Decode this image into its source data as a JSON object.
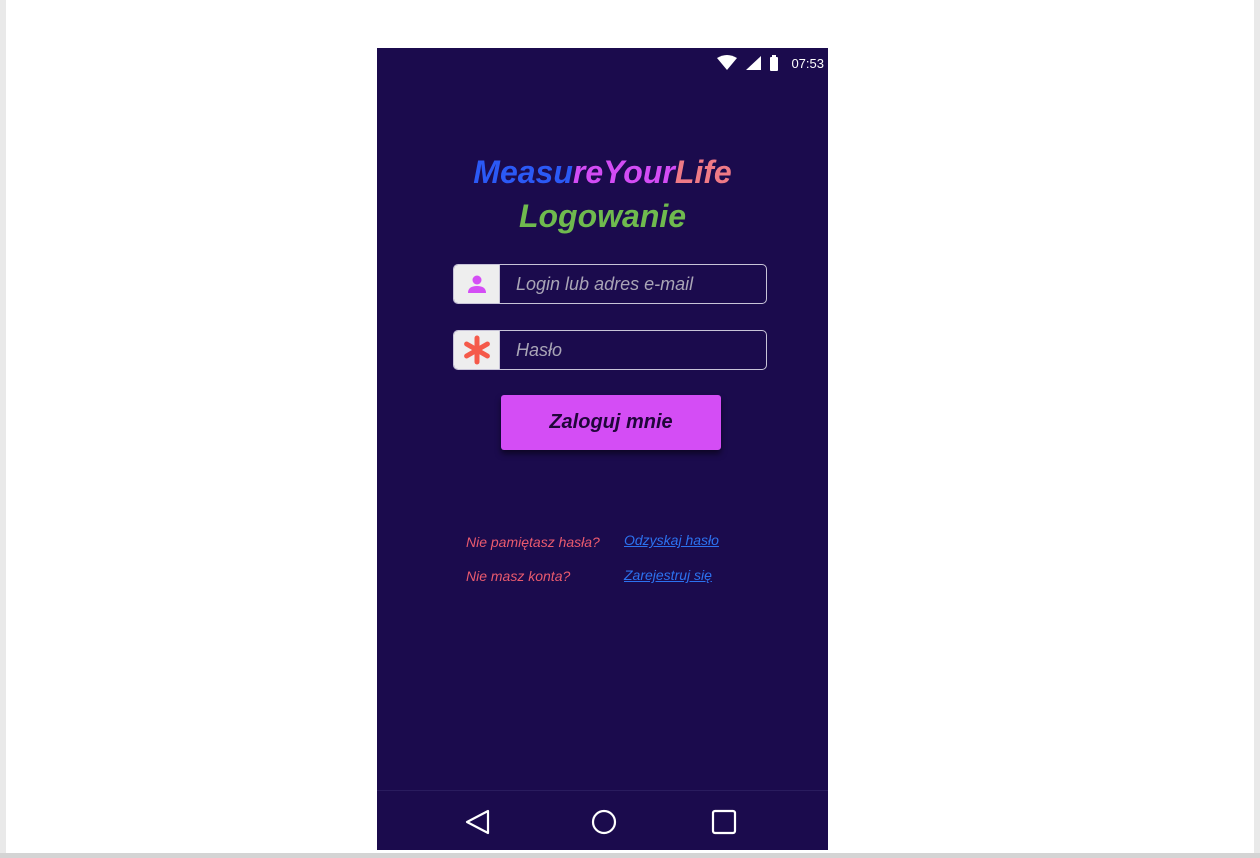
{
  "status_bar": {
    "time": "07:53",
    "icons": [
      "wifi-icon",
      "signal-icon",
      "battery-icon"
    ]
  },
  "header": {
    "app_title_parts": [
      "Measu",
      "reYour",
      "Life"
    ],
    "page_title": "Logowanie"
  },
  "form": {
    "login_placeholder": "Login lub adres e-mail",
    "login_value": "",
    "password_placeholder": "Hasło",
    "password_value": "",
    "submit_label": "Zaloguj mnie"
  },
  "links": {
    "forgot_question": "Nie pamiętasz hasła?",
    "forgot_link": "Odzyskaj hasło",
    "register_question": "Nie masz konta?",
    "register_link": "Zarejestruj się"
  },
  "nav_bar": {
    "icons": [
      "back-icon",
      "home-icon",
      "recents-icon"
    ]
  },
  "colors": {
    "background": "#1b0b4d",
    "title_blue": "#2b59f5",
    "title_purple": "#d34cf5",
    "title_salmon": "#ef7a86",
    "page_title_green": "#6fba4e",
    "button": "#d44df5",
    "question_red": "#ea5a6e",
    "link_blue": "#2c72f0",
    "user_icon": "#d44df5",
    "password_icon": "#f55a4a"
  }
}
